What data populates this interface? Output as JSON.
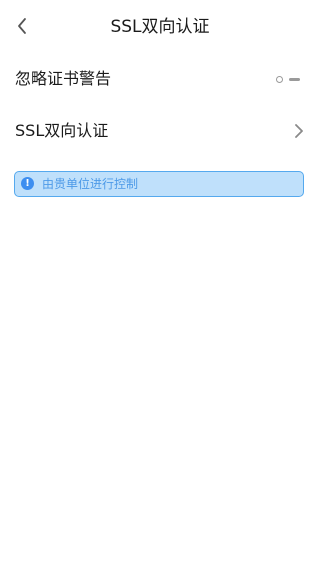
{
  "header": {
    "title": "SSL双向认证",
    "back_icon": "chevron-left-icon"
  },
  "settings": {
    "ignore_cert_warning": {
      "label": "忽略证书警告",
      "enabled": false
    },
    "ssl_mutual_auth": {
      "label": "SSL双向认证",
      "icon": "chevron-right-icon"
    }
  },
  "notice": {
    "text": "由贵单位进行控制",
    "icon": "info-icon",
    "background": "#bfe0fb",
    "border": "#55a9ee",
    "text_color": "#4d9ae8"
  }
}
